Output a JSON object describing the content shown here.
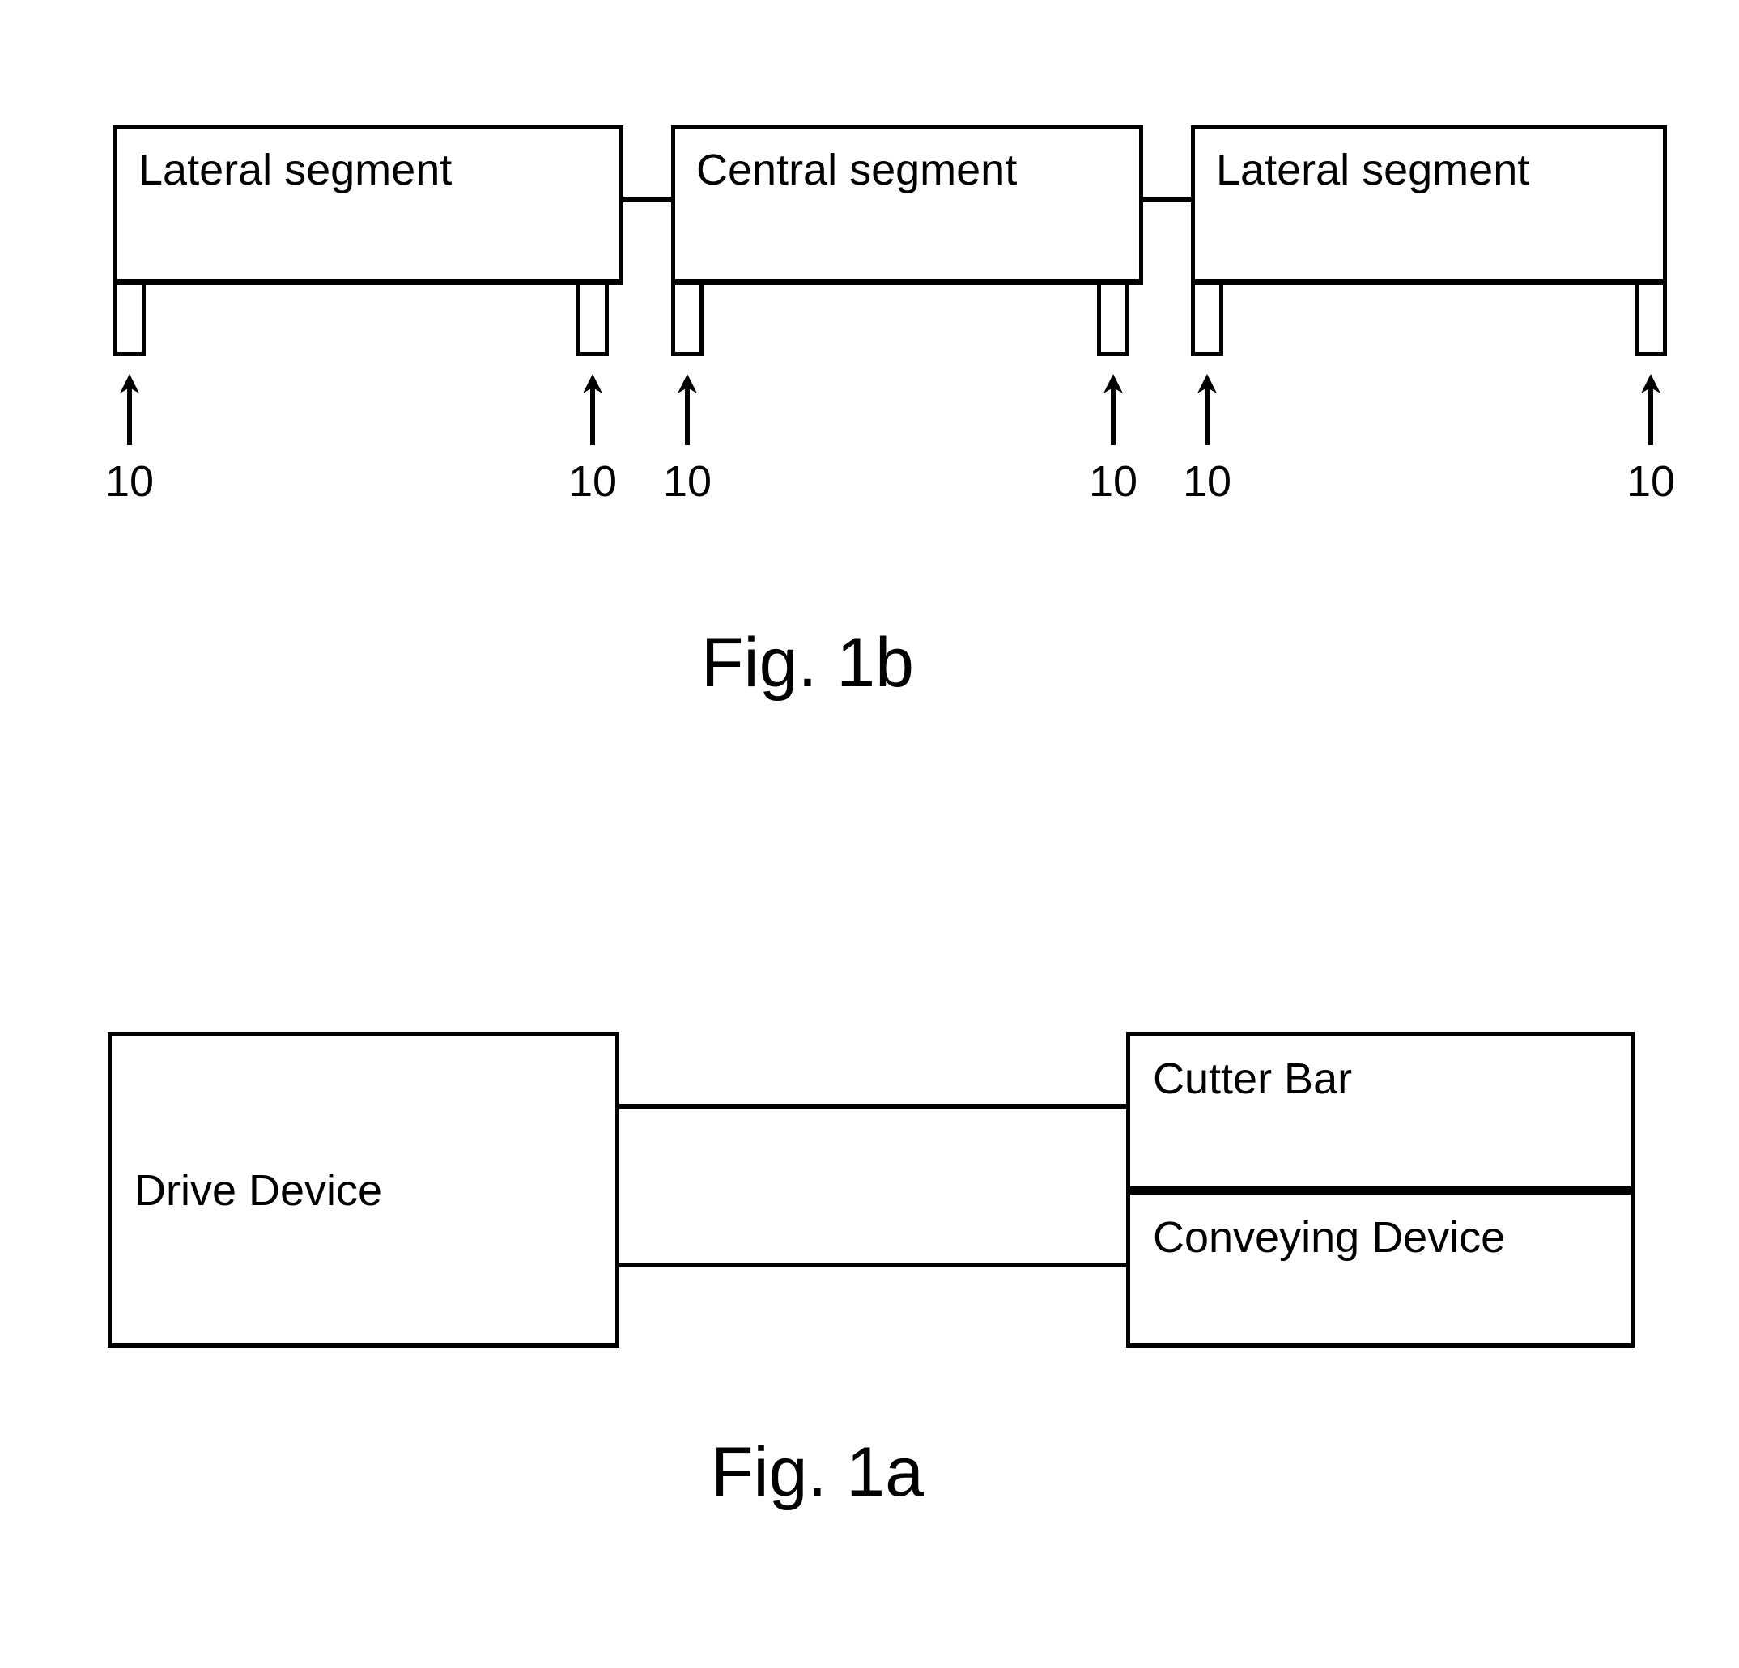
{
  "figures": [
    {
      "id": "fig-1b",
      "caption": "Fig. 1b",
      "segments": [
        {
          "label": "Lateral segment"
        },
        {
          "label": "Central segment"
        },
        {
          "label": "Lateral segment"
        }
      ],
      "callouts": [
        {
          "ref": "10"
        },
        {
          "ref": "10"
        },
        {
          "ref": "10"
        },
        {
          "ref": "10"
        },
        {
          "ref": "10"
        },
        {
          "ref": "10"
        }
      ]
    },
    {
      "id": "fig-1a",
      "caption": "Fig. 1a",
      "blocks": [
        {
          "label": "Drive Device"
        },
        {
          "label": "Cutter Bar"
        },
        {
          "label": "Conveying Device"
        }
      ]
    }
  ],
  "colors": {
    "stroke": "#000000",
    "background": "#ffffff",
    "text": "#000000"
  },
  "chart_data": {
    "type": "diagram",
    "title": "Patent drawing sheet — Fig. 1a and Fig. 1b",
    "figures": [
      {
        "name": "Fig. 1b",
        "description": "Segmented header bar shown in front elevation: three rectangular segments in a row (lateral, central, lateral), each supported by two downward legs; each leg is indicated by an upward arrow labelled 10.",
        "nodes": [
          "Lateral segment",
          "Central segment",
          "Lateral segment"
        ],
        "leg_labels": [
          "10",
          "10",
          "10",
          "10",
          "10",
          "10"
        ],
        "legs_per_segment": 2,
        "segment_count": 3
      },
      {
        "name": "Fig. 1a",
        "description": "Block diagram: a Drive Device block on the left connected by two horizontal lines to a stacked pair of blocks on the right, Cutter Bar above Conveying Device.",
        "nodes": [
          "Drive Device",
          "Cutter Bar",
          "Conveying Device"
        ],
        "edges": [
          {
            "from": "Drive Device",
            "to": "Cutter Bar"
          },
          {
            "from": "Drive Device",
            "to": "Conveying Device"
          }
        ]
      }
    ]
  }
}
